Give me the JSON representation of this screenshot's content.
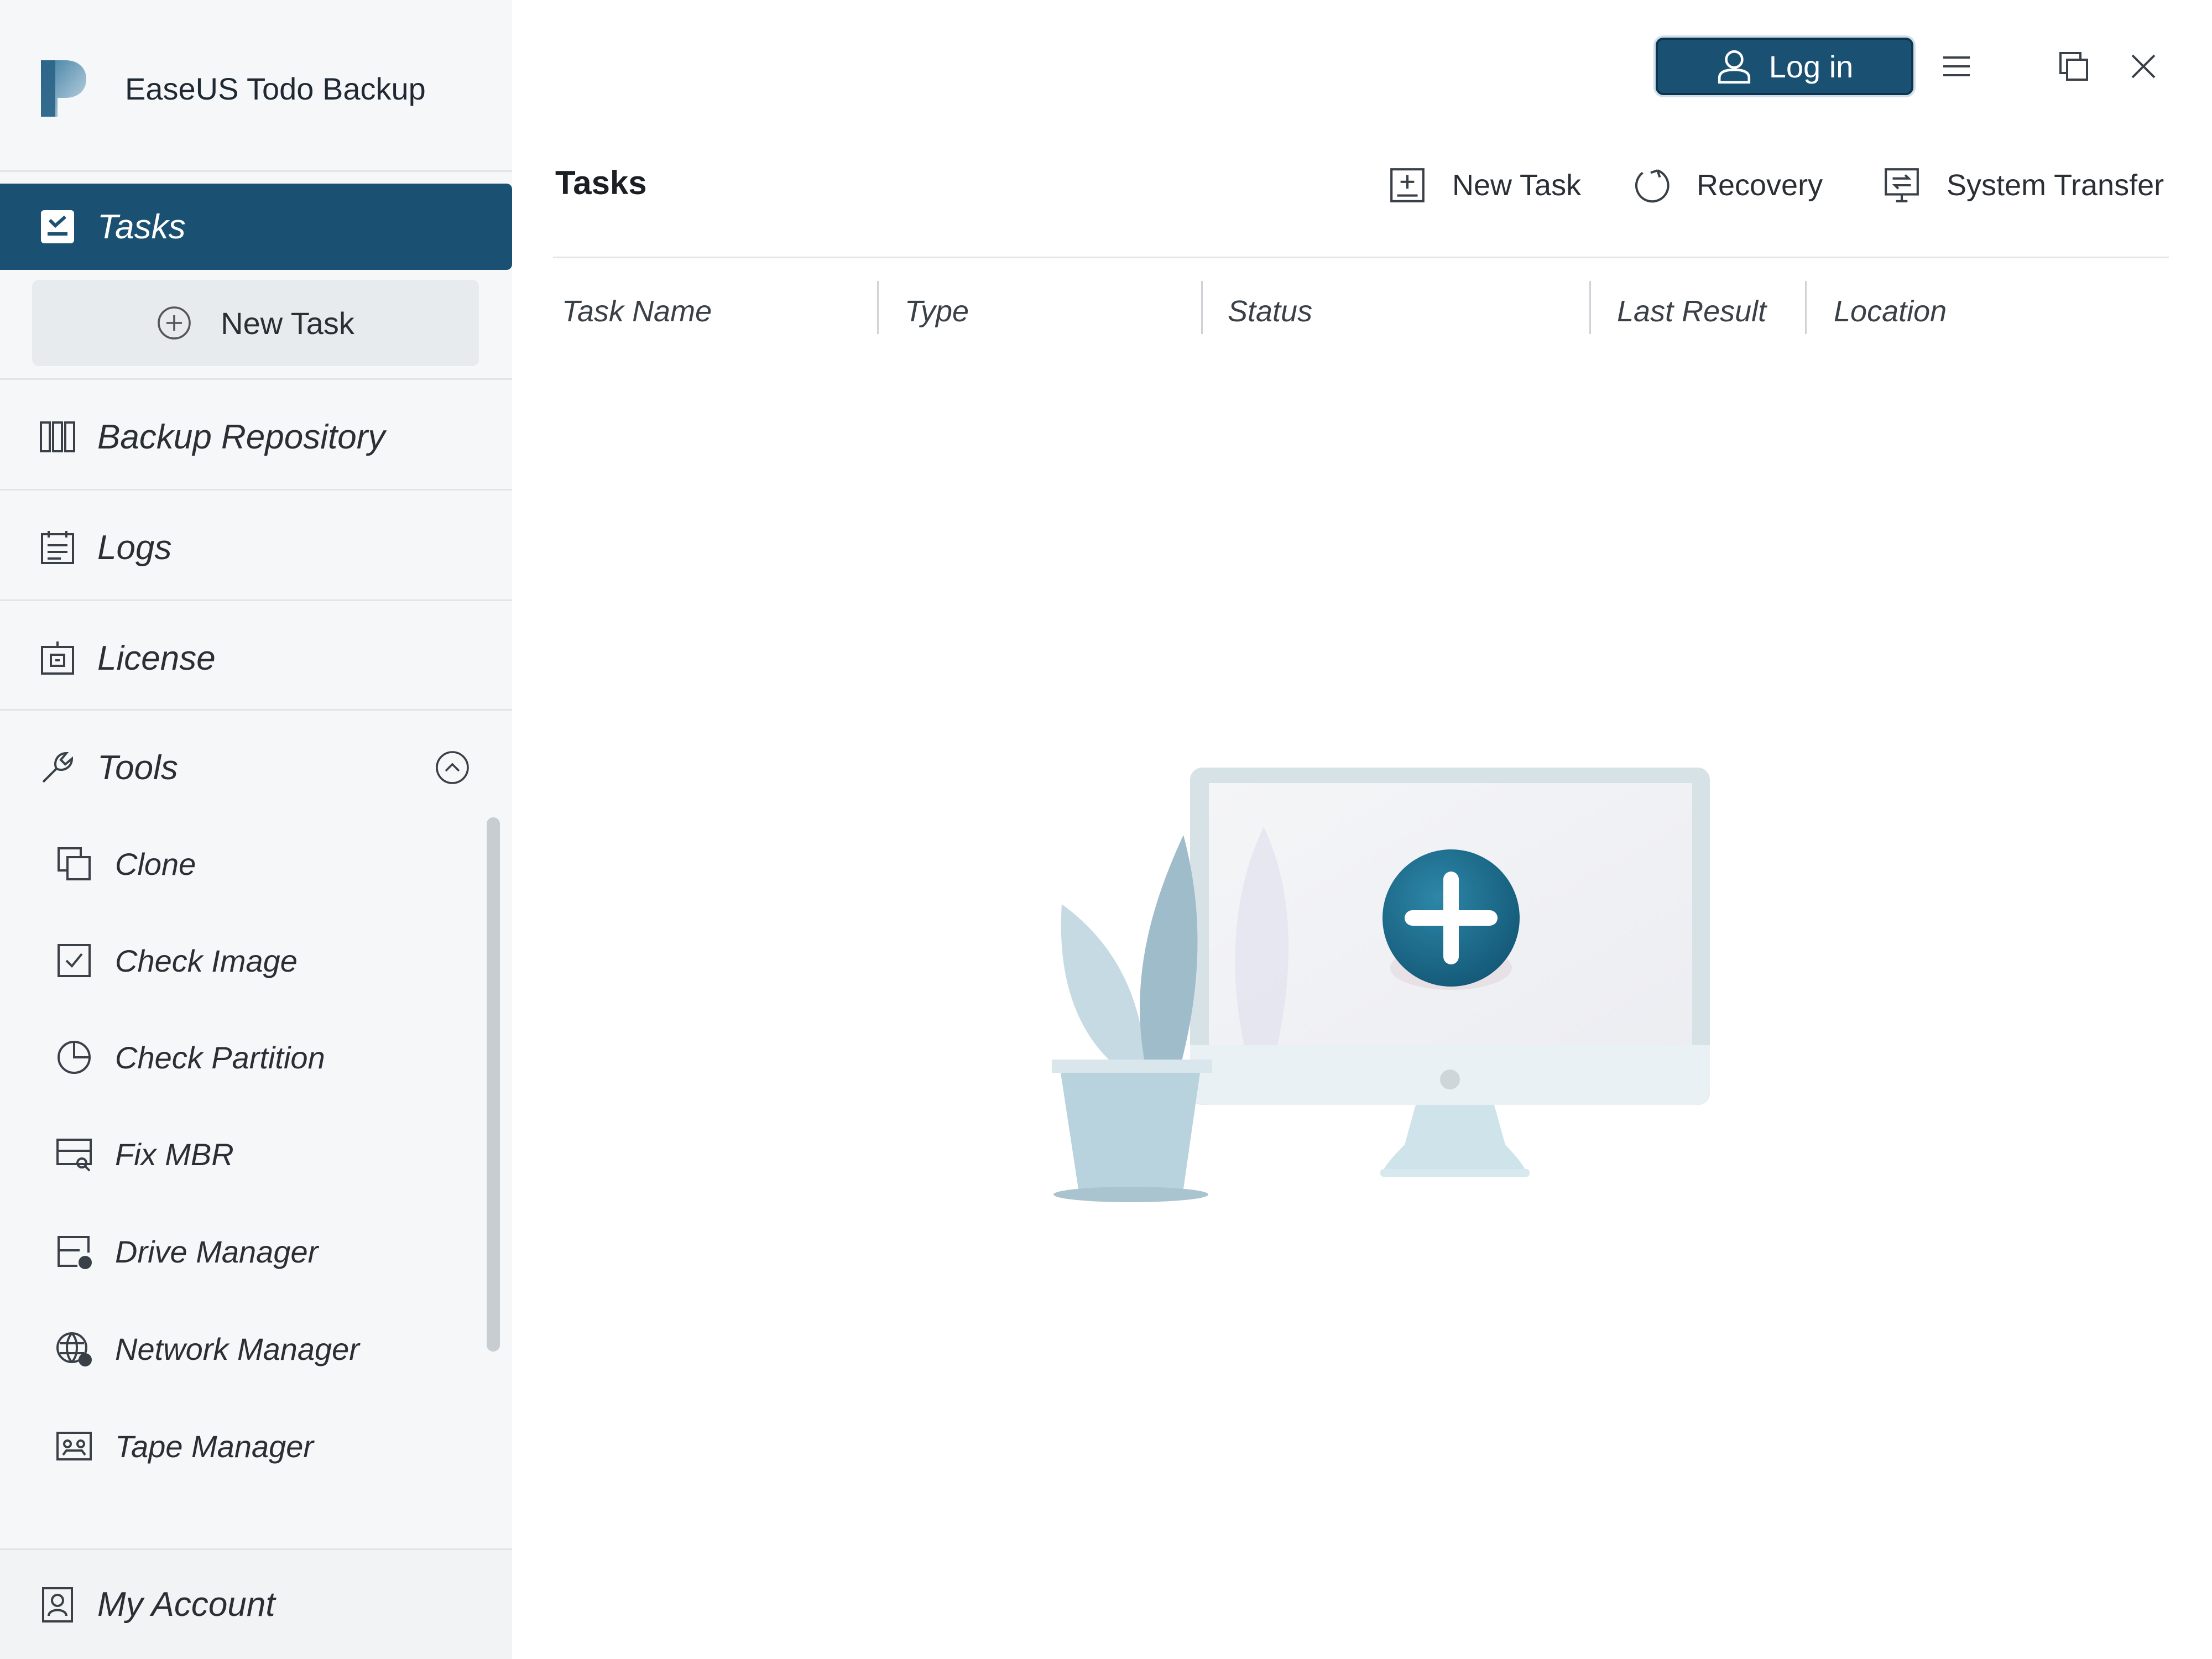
{
  "app": {
    "name": "EaseUS Todo Backup"
  },
  "titlebar": {
    "login_label": "Log in"
  },
  "sidebar": {
    "active_item": {
      "label": "Tasks",
      "icon": "tasks-icon"
    },
    "new_task_label": "New Task",
    "items": [
      {
        "label": "Backup Repository",
        "icon": "repository-icon"
      },
      {
        "label": "Logs",
        "icon": "logs-icon"
      },
      {
        "label": "License",
        "icon": "license-icon"
      }
    ],
    "tools": {
      "label": "Tools",
      "items": [
        {
          "label": "Clone",
          "icon": "clone-icon"
        },
        {
          "label": "Check Image",
          "icon": "check-image-icon"
        },
        {
          "label": "Check Partition",
          "icon": "check-partition-icon"
        },
        {
          "label": "Fix MBR",
          "icon": "fix-mbr-icon"
        },
        {
          "label": "Drive Manager",
          "icon": "drive-manager-icon"
        },
        {
          "label": "Network Manager",
          "icon": "network-manager-icon"
        },
        {
          "label": "Tape Manager",
          "icon": "tape-manager-icon"
        }
      ]
    },
    "account_label": "My Account"
  },
  "main": {
    "title": "Tasks",
    "actions": [
      {
        "label": "New Task",
        "icon": "new-task-icon"
      },
      {
        "label": "Recovery",
        "icon": "recovery-icon"
      },
      {
        "label": "System Transfer",
        "icon": "system-transfer-icon"
      }
    ],
    "columns": [
      "Task Name",
      "Type",
      "Status",
      "Last Result",
      "Location"
    ]
  },
  "colors": {
    "primary": "#1a5172",
    "sidebar_bg": "#f6f7f8",
    "accent_circle": "#1e6a8a"
  }
}
